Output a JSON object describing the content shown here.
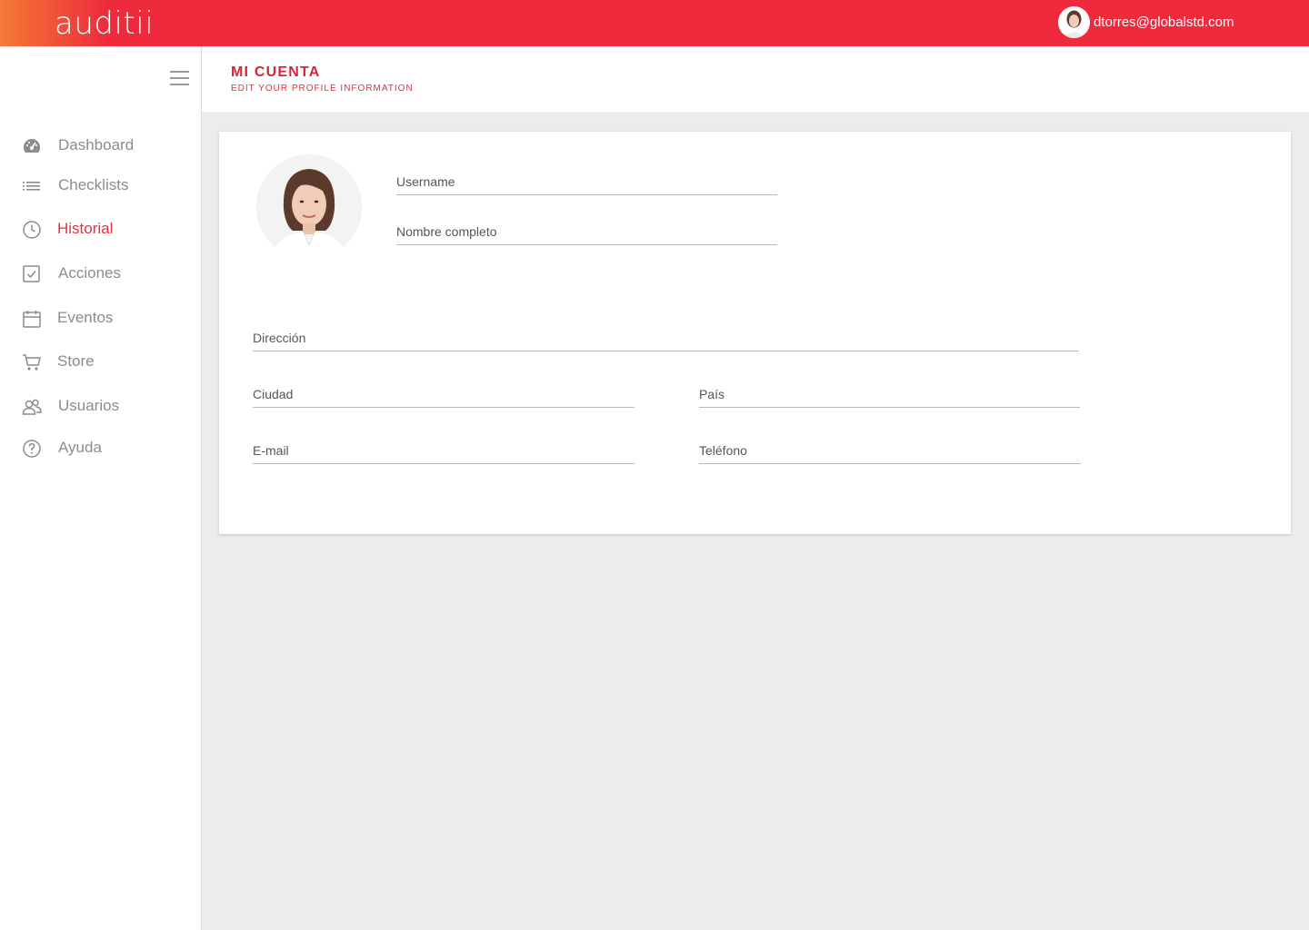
{
  "app": {
    "logo": "auditii"
  },
  "user": {
    "email": "dtorres@globalstd.com"
  },
  "sidebar": {
    "items": [
      {
        "label": "Dashboard",
        "icon": "dashboard-icon",
        "active": false
      },
      {
        "label": "Checklists",
        "icon": "list-icon",
        "active": false
      },
      {
        "label": "Historial",
        "icon": "clock-icon",
        "active": true
      },
      {
        "label": "Acciones",
        "icon": "checkbox-icon",
        "active": false
      },
      {
        "label": "Eventos",
        "icon": "calendar-icon",
        "active": false
      },
      {
        "label": "Store",
        "icon": "cart-icon",
        "active": false
      },
      {
        "label": "Usuarios",
        "icon": "users-icon",
        "active": false
      },
      {
        "label": "Ayuda",
        "icon": "help-icon",
        "active": false
      }
    ]
  },
  "page": {
    "title": "MI CUENTA",
    "subtitle": "EDIT YOUR PROFILE INFORMATION"
  },
  "form": {
    "username": {
      "placeholder": "Username",
      "value": ""
    },
    "fullname": {
      "placeholder": "Nombre completo",
      "value": ""
    },
    "address": {
      "placeholder": "Dirección",
      "value": ""
    },
    "city": {
      "placeholder": "Ciudad",
      "value": ""
    },
    "country": {
      "placeholder": "País",
      "value": ""
    },
    "email": {
      "placeholder": "E-mail",
      "value": ""
    },
    "phone": {
      "placeholder": "Teléfono",
      "value": ""
    }
  },
  "colors": {
    "brand": "#ee2a3c",
    "brand_gradient_start": "#f47a35",
    "active": "#e4303f"
  }
}
